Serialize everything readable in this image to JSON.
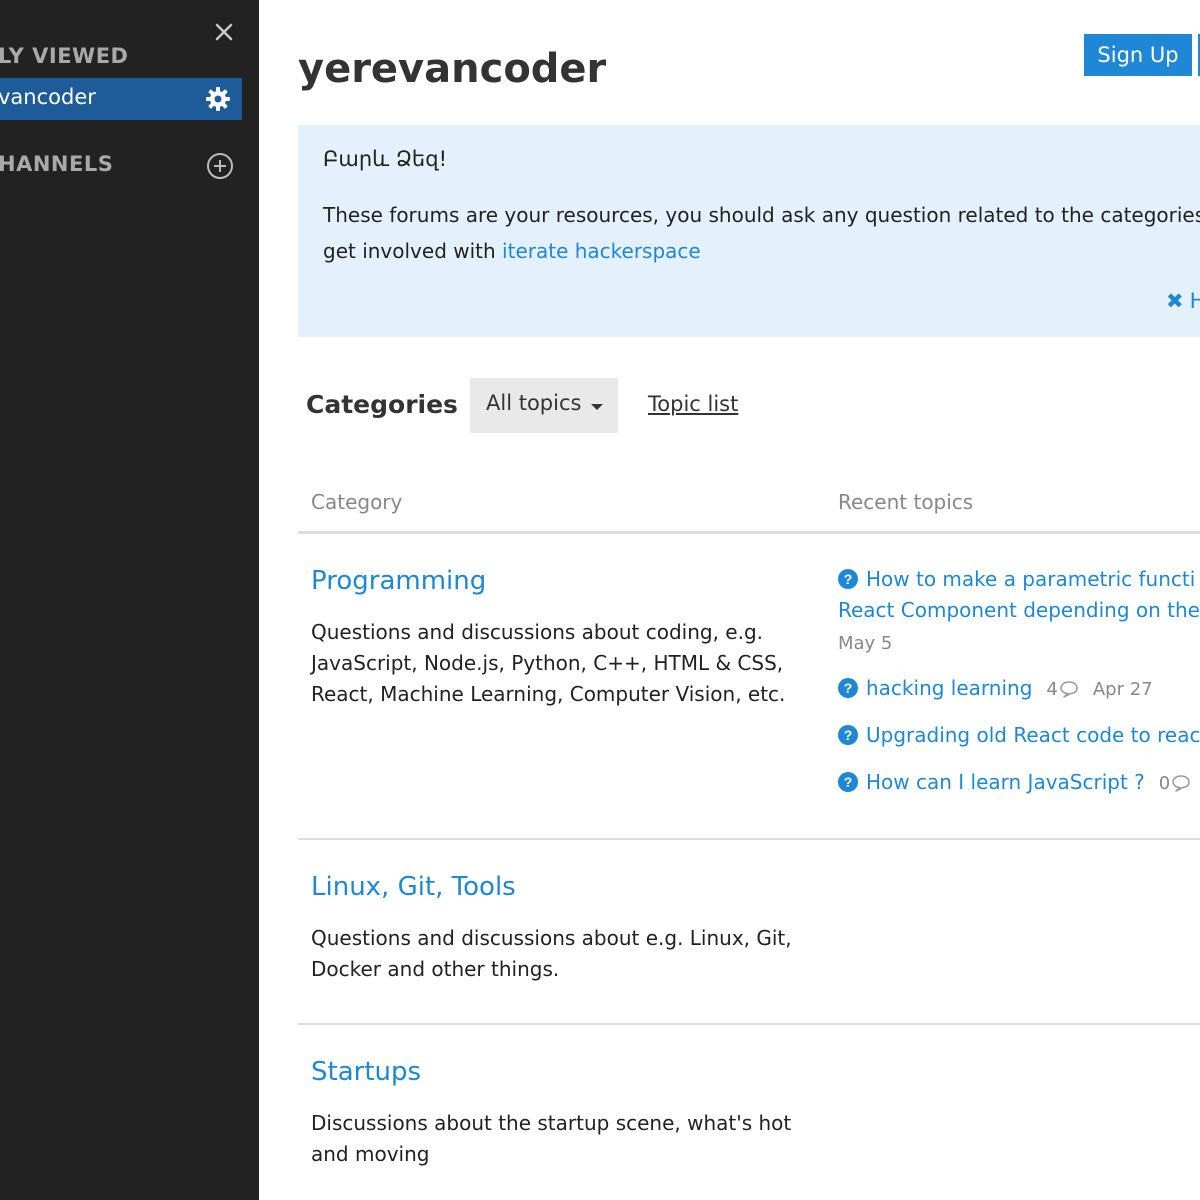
{
  "sidebar": {
    "recently_viewed_title": "LY VIEWED",
    "active_item_label": "vancoder",
    "channels_title": "HANNELS"
  },
  "header": {
    "title": "yerevancoder",
    "signup_label": "Sign Up"
  },
  "banner": {
    "greeting": "Բարև Ձեզ!",
    "text_line1": "These forums are your resources, you should ask any question related to the categories",
    "text_line2_prefix": "get involved with ",
    "link_text": "iterate hackerspace",
    "hide_label": "H"
  },
  "nav": {
    "categories_label": "Categories",
    "dropdown_label": "All topics",
    "topic_list_label": "Topic list"
  },
  "table": {
    "col_category": "Category",
    "col_recent": "Recent topics"
  },
  "categories": [
    {
      "name": "Programming",
      "desc_lines": [
        "Questions and discussions about coding, e.g.",
        "JavaScript, Node.js, Python, C++, HTML & CSS,",
        "React, Machine Learning, Computer Vision, etc."
      ],
      "topics": [
        {
          "title_line1": "How to make a parametric functi",
          "title_line2": "React Component depending on the",
          "date": "May 5"
        },
        {
          "title": "hacking learning",
          "replies": "4",
          "date": "Apr 27"
        },
        {
          "title": "Upgrading old React code to reac"
        },
        {
          "title": "How can I learn JavaScript ?",
          "replies": "0"
        }
      ]
    },
    {
      "name": "Linux, Git, Tools",
      "desc_lines": [
        "Questions and discussions about e.g. Linux, Git,",
        "Docker and other things."
      ]
    },
    {
      "name": "Startups",
      "desc_lines": [
        "Discussions about the startup scene, what's hot",
        "and moving"
      ]
    }
  ],
  "colors": {
    "sidebar_bg": "#222222",
    "sidebar_active": "#1d5c99",
    "accent": "#1e88d6",
    "banner_bg": "#e4f1fc"
  },
  "icons": {
    "close": "close-icon",
    "gear": "gear-icon",
    "add": "plus-circle-icon",
    "question": "question-circle-icon",
    "reply": "speech-bubble-icon"
  }
}
